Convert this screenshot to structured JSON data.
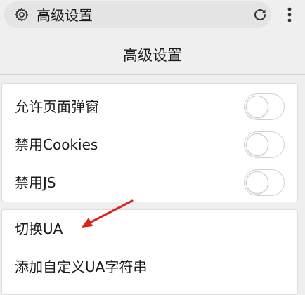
{
  "address_bar": {
    "text": "高级设置",
    "site_icon": "gear-icon",
    "reload_icon": "reload-icon",
    "menu_icon": "more-vert-icon"
  },
  "page": {
    "title": "高级设置"
  },
  "sections": {
    "toggles": [
      {
        "label": "允许页面弹窗",
        "enabled": false
      },
      {
        "label": "禁用Cookies",
        "enabled": false
      },
      {
        "label": "禁用JS",
        "enabled": false
      }
    ],
    "ua": [
      {
        "label": "切换UA"
      },
      {
        "label": "添加自定义UA字符串"
      }
    ]
  },
  "annotation": {
    "arrow_color": "#e0211b"
  }
}
